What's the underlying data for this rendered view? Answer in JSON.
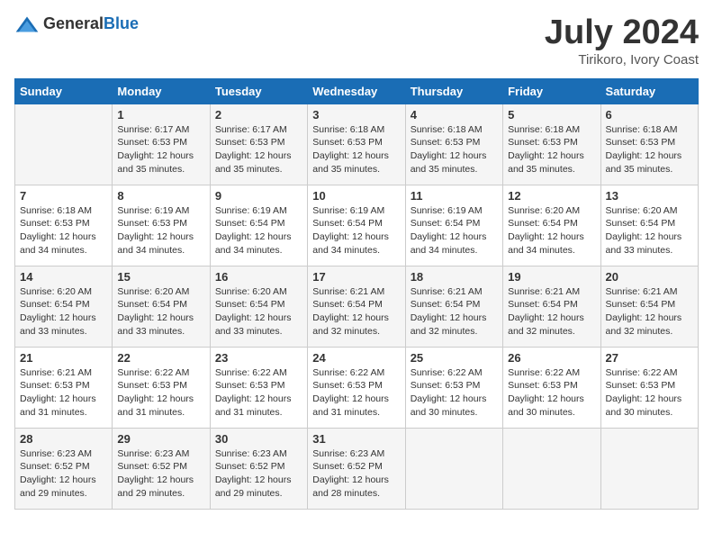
{
  "header": {
    "logo_general": "General",
    "logo_blue": "Blue",
    "month_year": "July 2024",
    "location": "Tirikoro, Ivory Coast"
  },
  "days_of_week": [
    "Sunday",
    "Monday",
    "Tuesday",
    "Wednesday",
    "Thursday",
    "Friday",
    "Saturday"
  ],
  "weeks": [
    [
      {
        "day": "",
        "info": ""
      },
      {
        "day": "1",
        "info": "Sunrise: 6:17 AM\nSunset: 6:53 PM\nDaylight: 12 hours and 35 minutes."
      },
      {
        "day": "2",
        "info": "Sunrise: 6:17 AM\nSunset: 6:53 PM\nDaylight: 12 hours and 35 minutes."
      },
      {
        "day": "3",
        "info": "Sunrise: 6:18 AM\nSunset: 6:53 PM\nDaylight: 12 hours and 35 minutes."
      },
      {
        "day": "4",
        "info": "Sunrise: 6:18 AM\nSunset: 6:53 PM\nDaylight: 12 hours and 35 minutes."
      },
      {
        "day": "5",
        "info": "Sunrise: 6:18 AM\nSunset: 6:53 PM\nDaylight: 12 hours and 35 minutes."
      },
      {
        "day": "6",
        "info": "Sunrise: 6:18 AM\nSunset: 6:53 PM\nDaylight: 12 hours and 35 minutes."
      }
    ],
    [
      {
        "day": "7",
        "info": "Sunrise: 6:18 AM\nSunset: 6:53 PM\nDaylight: 12 hours and 34 minutes."
      },
      {
        "day": "8",
        "info": "Sunrise: 6:19 AM\nSunset: 6:53 PM\nDaylight: 12 hours and 34 minutes."
      },
      {
        "day": "9",
        "info": "Sunrise: 6:19 AM\nSunset: 6:54 PM\nDaylight: 12 hours and 34 minutes."
      },
      {
        "day": "10",
        "info": "Sunrise: 6:19 AM\nSunset: 6:54 PM\nDaylight: 12 hours and 34 minutes."
      },
      {
        "day": "11",
        "info": "Sunrise: 6:19 AM\nSunset: 6:54 PM\nDaylight: 12 hours and 34 minutes."
      },
      {
        "day": "12",
        "info": "Sunrise: 6:20 AM\nSunset: 6:54 PM\nDaylight: 12 hours and 34 minutes."
      },
      {
        "day": "13",
        "info": "Sunrise: 6:20 AM\nSunset: 6:54 PM\nDaylight: 12 hours and 33 minutes."
      }
    ],
    [
      {
        "day": "14",
        "info": "Sunrise: 6:20 AM\nSunset: 6:54 PM\nDaylight: 12 hours and 33 minutes."
      },
      {
        "day": "15",
        "info": "Sunrise: 6:20 AM\nSunset: 6:54 PM\nDaylight: 12 hours and 33 minutes."
      },
      {
        "day": "16",
        "info": "Sunrise: 6:20 AM\nSunset: 6:54 PM\nDaylight: 12 hours and 33 minutes."
      },
      {
        "day": "17",
        "info": "Sunrise: 6:21 AM\nSunset: 6:54 PM\nDaylight: 12 hours and 32 minutes."
      },
      {
        "day": "18",
        "info": "Sunrise: 6:21 AM\nSunset: 6:54 PM\nDaylight: 12 hours and 32 minutes."
      },
      {
        "day": "19",
        "info": "Sunrise: 6:21 AM\nSunset: 6:54 PM\nDaylight: 12 hours and 32 minutes."
      },
      {
        "day": "20",
        "info": "Sunrise: 6:21 AM\nSunset: 6:54 PM\nDaylight: 12 hours and 32 minutes."
      }
    ],
    [
      {
        "day": "21",
        "info": "Sunrise: 6:21 AM\nSunset: 6:53 PM\nDaylight: 12 hours and 31 minutes."
      },
      {
        "day": "22",
        "info": "Sunrise: 6:22 AM\nSunset: 6:53 PM\nDaylight: 12 hours and 31 minutes."
      },
      {
        "day": "23",
        "info": "Sunrise: 6:22 AM\nSunset: 6:53 PM\nDaylight: 12 hours and 31 minutes."
      },
      {
        "day": "24",
        "info": "Sunrise: 6:22 AM\nSunset: 6:53 PM\nDaylight: 12 hours and 31 minutes."
      },
      {
        "day": "25",
        "info": "Sunrise: 6:22 AM\nSunset: 6:53 PM\nDaylight: 12 hours and 30 minutes."
      },
      {
        "day": "26",
        "info": "Sunrise: 6:22 AM\nSunset: 6:53 PM\nDaylight: 12 hours and 30 minutes."
      },
      {
        "day": "27",
        "info": "Sunrise: 6:22 AM\nSunset: 6:53 PM\nDaylight: 12 hours and 30 minutes."
      }
    ],
    [
      {
        "day": "28",
        "info": "Sunrise: 6:23 AM\nSunset: 6:52 PM\nDaylight: 12 hours and 29 minutes."
      },
      {
        "day": "29",
        "info": "Sunrise: 6:23 AM\nSunset: 6:52 PM\nDaylight: 12 hours and 29 minutes."
      },
      {
        "day": "30",
        "info": "Sunrise: 6:23 AM\nSunset: 6:52 PM\nDaylight: 12 hours and 29 minutes."
      },
      {
        "day": "31",
        "info": "Sunrise: 6:23 AM\nSunset: 6:52 PM\nDaylight: 12 hours and 28 minutes."
      },
      {
        "day": "",
        "info": ""
      },
      {
        "day": "",
        "info": ""
      },
      {
        "day": "",
        "info": ""
      }
    ]
  ]
}
